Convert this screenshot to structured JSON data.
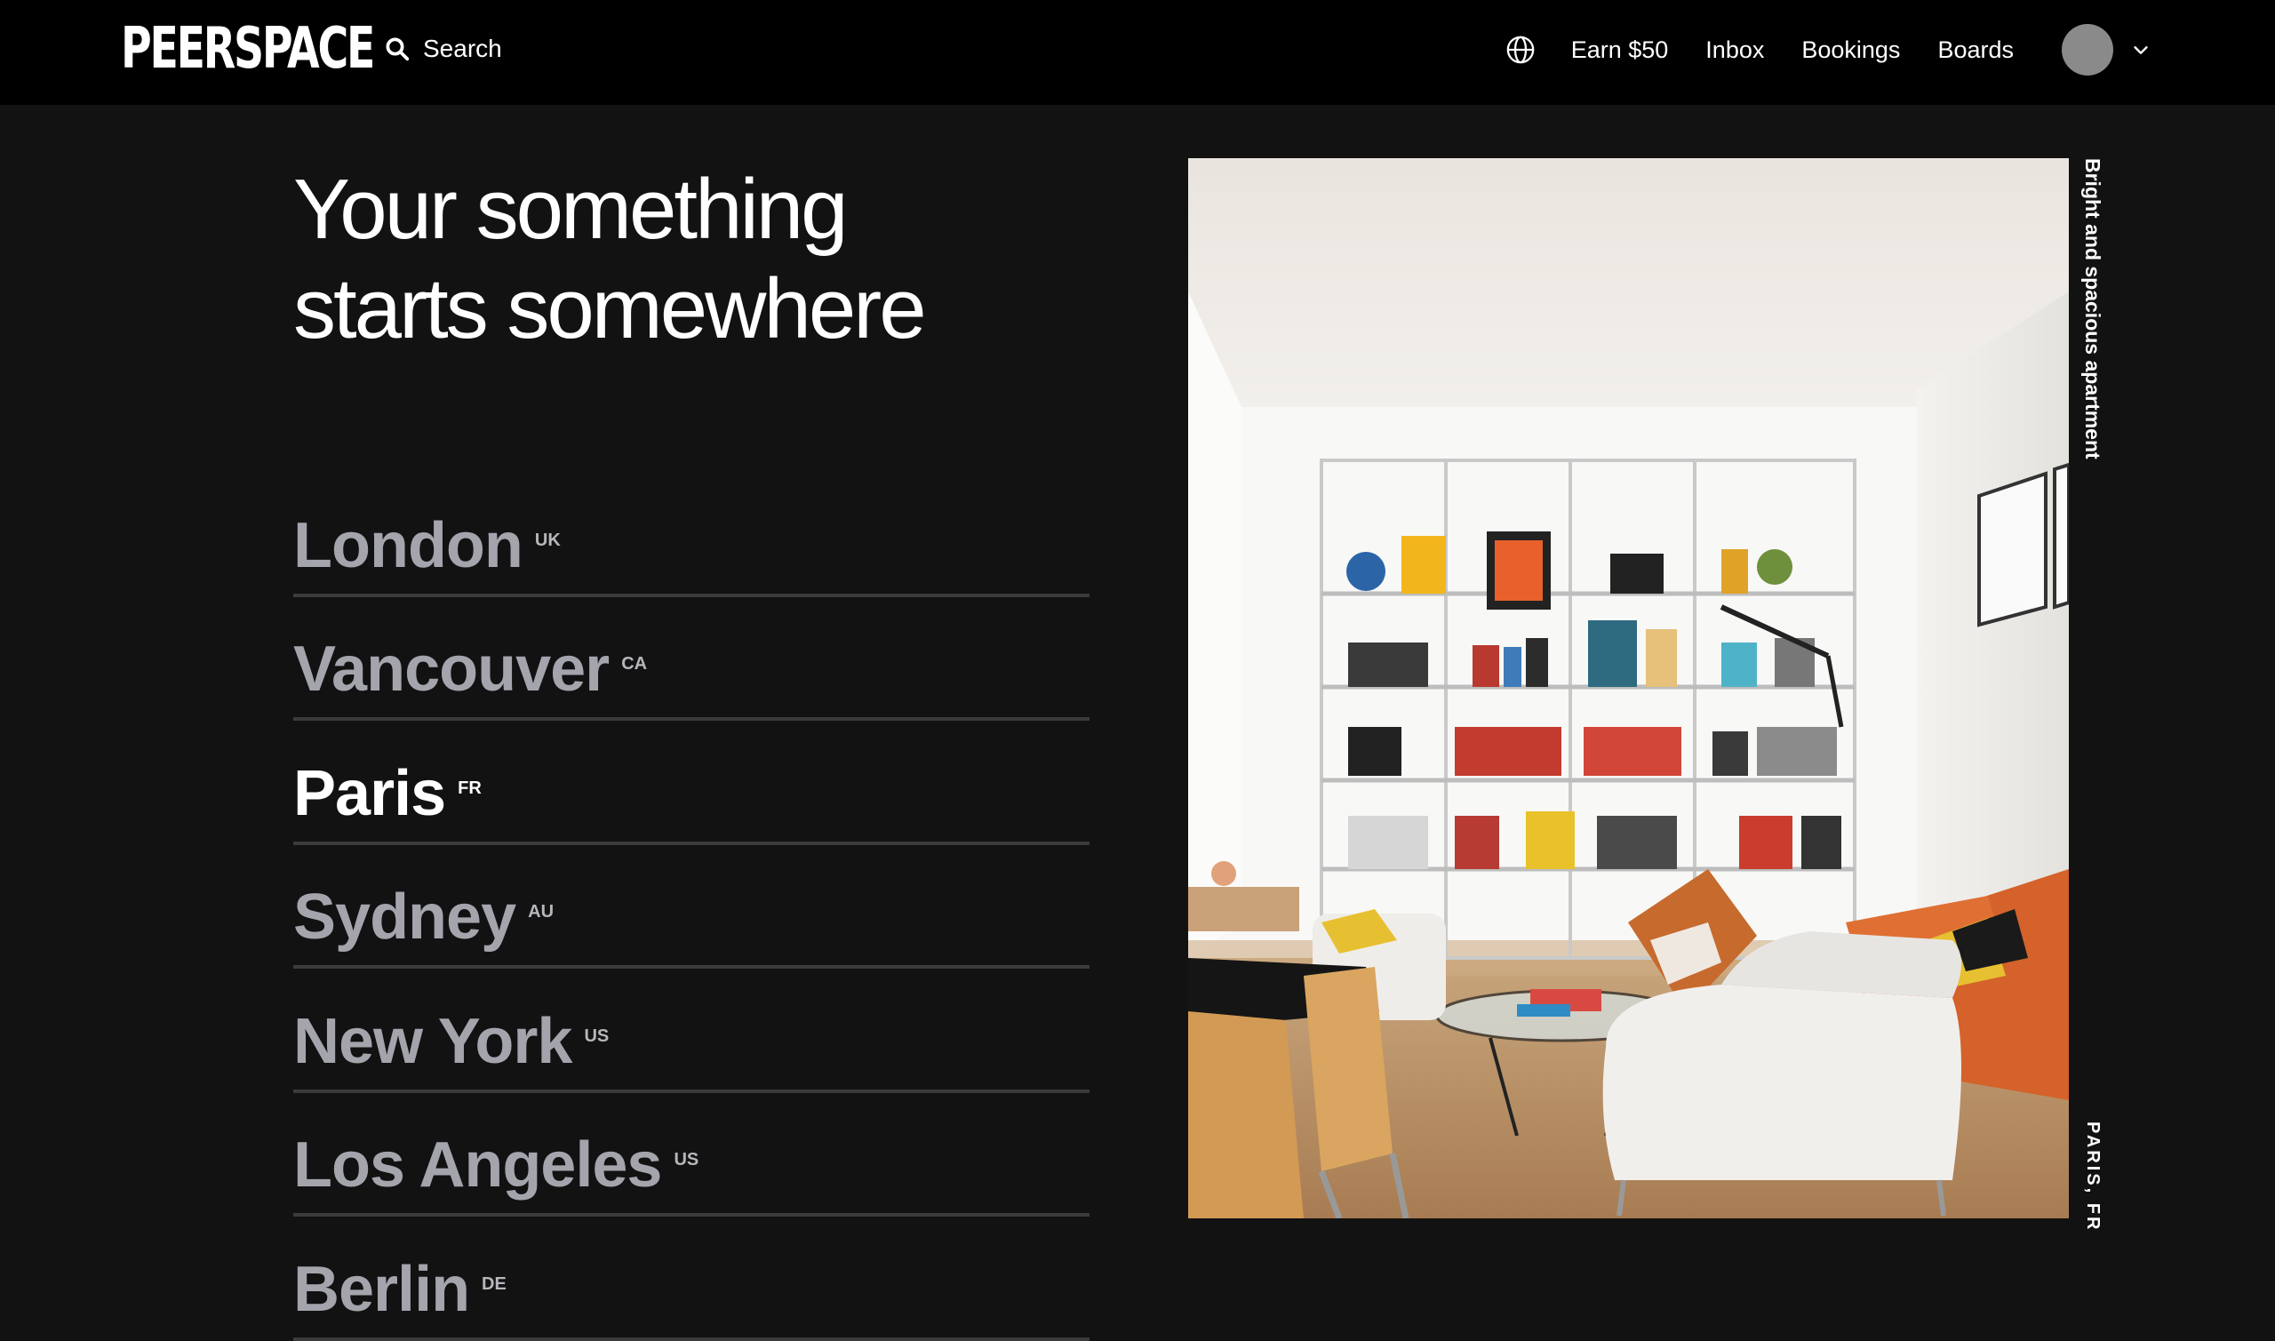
{
  "nav": {
    "logo": "PEERSPACE",
    "search_label": "Search",
    "links": [
      "Earn $50",
      "Inbox",
      "Bookings",
      "Boards"
    ],
    "icons": {
      "search": "search-icon",
      "globe": "globe-icon",
      "avatar": "avatar",
      "dropdown": "chevron-down-icon"
    }
  },
  "hero": {
    "headline_line1": "Your something",
    "headline_line2": "starts somewhere"
  },
  "cities": [
    {
      "name": "London",
      "code": "UK",
      "active": false
    },
    {
      "name": "Vancouver",
      "code": "CA",
      "active": false
    },
    {
      "name": "Paris",
      "code": "FR",
      "active": true
    },
    {
      "name": "Sydney",
      "code": "AU",
      "active": false
    },
    {
      "name": "New York",
      "code": "US",
      "active": false
    },
    {
      "name": "Los Angeles",
      "code": "US",
      "active": false
    },
    {
      "name": "Berlin",
      "code": "DE",
      "active": false
    }
  ],
  "featured": {
    "caption": "Bright and spacious apartment",
    "location": "PARIS, FR"
  },
  "colors": {
    "nav_bg": "#000000",
    "page_bg": "#121212",
    "inactive_city": "#a4a4ad",
    "active_city": "#ffffff",
    "divider": "#3b3b3b"
  }
}
